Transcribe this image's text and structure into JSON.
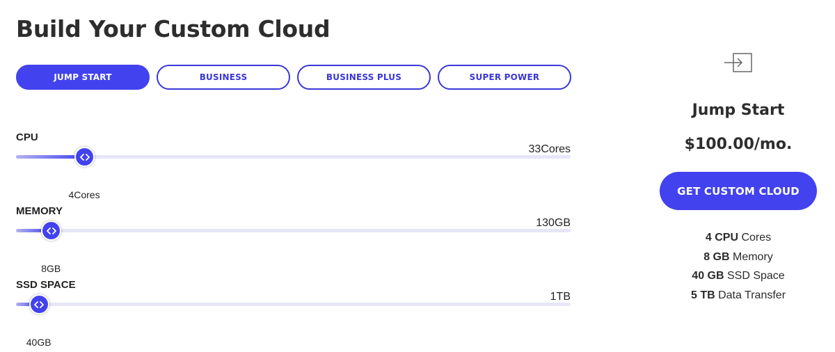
{
  "page": {
    "title": "Build Your Custom Cloud"
  },
  "colors": {
    "accent": "#4242ef",
    "text": "#2d2d2d",
    "track": "#e6e6f8"
  },
  "tabs": [
    {
      "label": "JUMP START",
      "active": true
    },
    {
      "label": "BUSINESS",
      "active": false
    },
    {
      "label": "BUSINESS PLUS",
      "active": false
    },
    {
      "label": "SUPER POWER",
      "active": false
    }
  ],
  "sliders": {
    "cpu": {
      "label": "CPU",
      "max_label": "33Cores",
      "value_label": "4Cores",
      "fraction": 0.123,
      "thumb_icon": "code-arrows-icon"
    },
    "memory": {
      "label": "MEMORY",
      "max_label": "130GB",
      "value_label": "8GB",
      "fraction": 0.063,
      "thumb_icon": "code-arrows-icon"
    },
    "ssd": {
      "label": "SSD SPACE",
      "max_label": "1TB",
      "value_label": "40GB",
      "fraction": 0.041,
      "thumb_icon": "code-arrows-icon"
    }
  },
  "summary": {
    "icon": "sign-in-arrow-icon",
    "plan_name": "Jump Start",
    "price": "$100.00/mo.",
    "cta_label": "GET CUSTOM CLOUD",
    "specs": [
      {
        "value": "4 CPU",
        "unit": " Cores"
      },
      {
        "value": "8 GB",
        "unit": " Memory"
      },
      {
        "value": "40 GB",
        "unit": " SSD Space"
      },
      {
        "value": "5 TB",
        "unit": " Data Transfer"
      }
    ]
  }
}
